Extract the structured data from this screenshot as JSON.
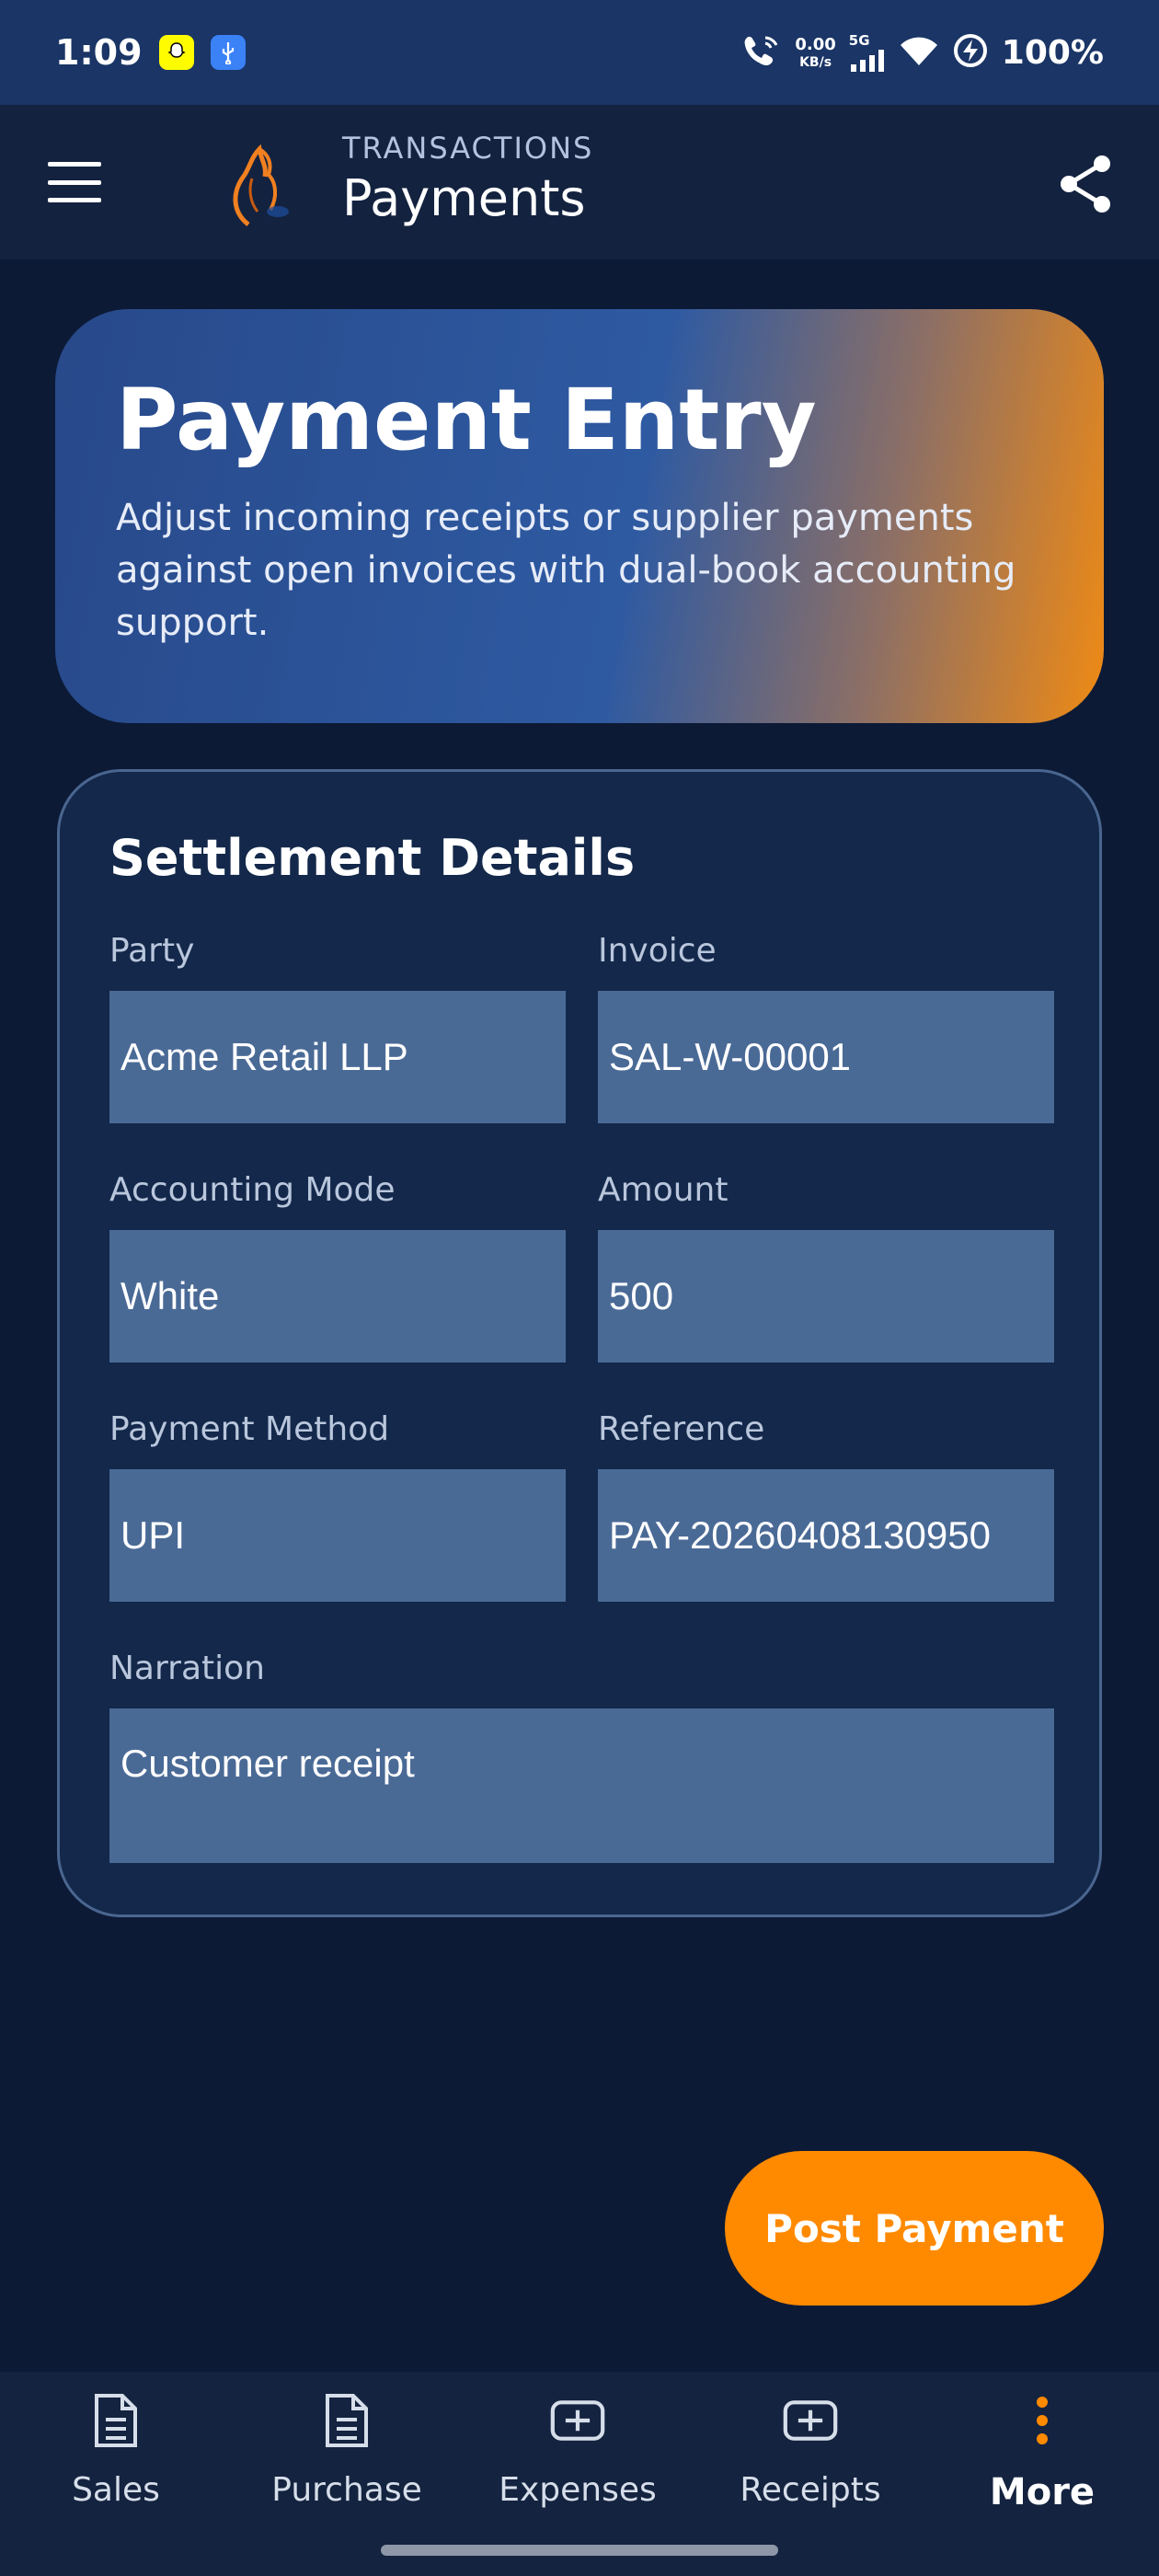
{
  "status_bar": {
    "time": "1:09",
    "net_speed_value": "0.00",
    "net_speed_unit": "KB/s",
    "network_type": "5G",
    "battery": "100%"
  },
  "app_bar": {
    "subtitle": "TRANSACTIONS",
    "title": "Payments"
  },
  "hero": {
    "title": "Payment Entry",
    "description": "Adjust incoming receipts or supplier payments against open invoices with dual-book accounting support."
  },
  "form": {
    "title": "Settlement Details",
    "fields": {
      "party": {
        "label": "Party",
        "value": "Acme Retail LLP"
      },
      "invoice": {
        "label": "Invoice",
        "value": "SAL-W-00001"
      },
      "accounting_mode": {
        "label": "Accounting Mode",
        "value": "White"
      },
      "amount": {
        "label": "Amount",
        "value": "500"
      },
      "payment_method": {
        "label": "Payment Method",
        "value": "UPI"
      },
      "reference": {
        "label": "Reference",
        "value": "PAY-20260408130950"
      },
      "narration": {
        "label": "Narration",
        "value": "Customer receipt"
      }
    }
  },
  "actions": {
    "post_label": "Post Payment"
  },
  "bottom_nav": {
    "items": [
      {
        "label": "Sales",
        "icon": "document-icon"
      },
      {
        "label": "Purchase",
        "icon": "document-icon"
      },
      {
        "label": "Expenses",
        "icon": "plus-box-icon"
      },
      {
        "label": "Receipts",
        "icon": "plus-box-icon"
      },
      {
        "label": "More",
        "icon": "more-vertical-icon",
        "active": true
      }
    ]
  },
  "colors": {
    "background": "#0c1a36",
    "status_bar": "#1a3566",
    "accent": "#ff8a00",
    "field": "#4a6a96"
  }
}
